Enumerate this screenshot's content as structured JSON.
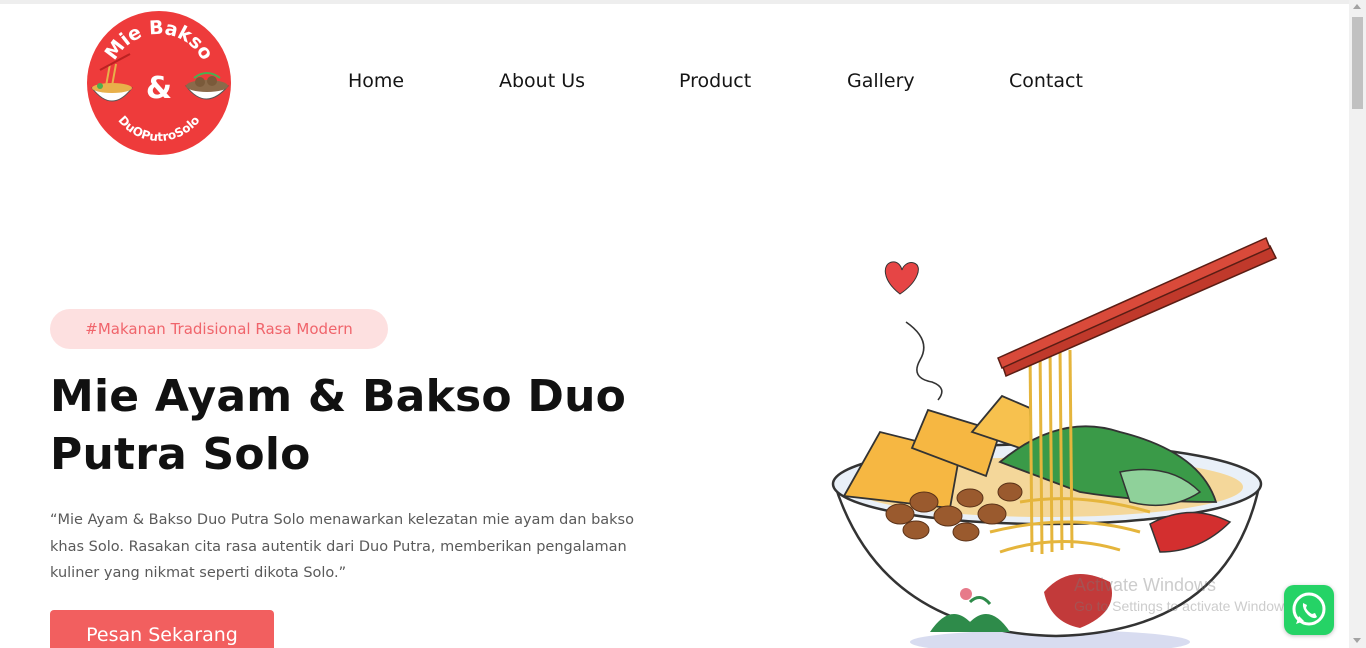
{
  "brand": {
    "logo_top_text": "Mie Bakso",
    "logo_mid_text": "&",
    "logo_bottom_text": "DuOPutroSolo",
    "logo_icon": "noodle-bowl-logo-icon"
  },
  "nav": {
    "items": [
      {
        "label": "Home"
      },
      {
        "label": "About Us"
      },
      {
        "label": "Product"
      },
      {
        "label": "Gallery"
      },
      {
        "label": "Contact"
      }
    ]
  },
  "hero": {
    "tag": "#Makanan Tradisional Rasa Modern",
    "title_line1": "Mie Ayam & Bakso Duo",
    "title_line2": "Putra Solo",
    "description": "“Mie Ayam & Bakso Duo Putra Solo menawarkan kelezatan mie ayam dan bakso khas Solo. Rasakan cita rasa autentik dari Duo Putra, memberikan pengalaman kuliner yang nikmat seperti dikota Solo.”",
    "cta_label": "Pesan Sekarang",
    "illustration_icon": "noodle-bowl-illustration"
  },
  "watermark": {
    "line1": "Activate Windows",
    "line2": "Go to Settings to activate Windows."
  },
  "whatsapp": {
    "icon": "whatsapp-icon"
  },
  "colors": {
    "accent": "#f25f5f",
    "tag_bg": "#fde0e0",
    "tag_text": "#f0646b",
    "logo_red": "#ee3b3b",
    "whatsapp": "#25d366"
  }
}
